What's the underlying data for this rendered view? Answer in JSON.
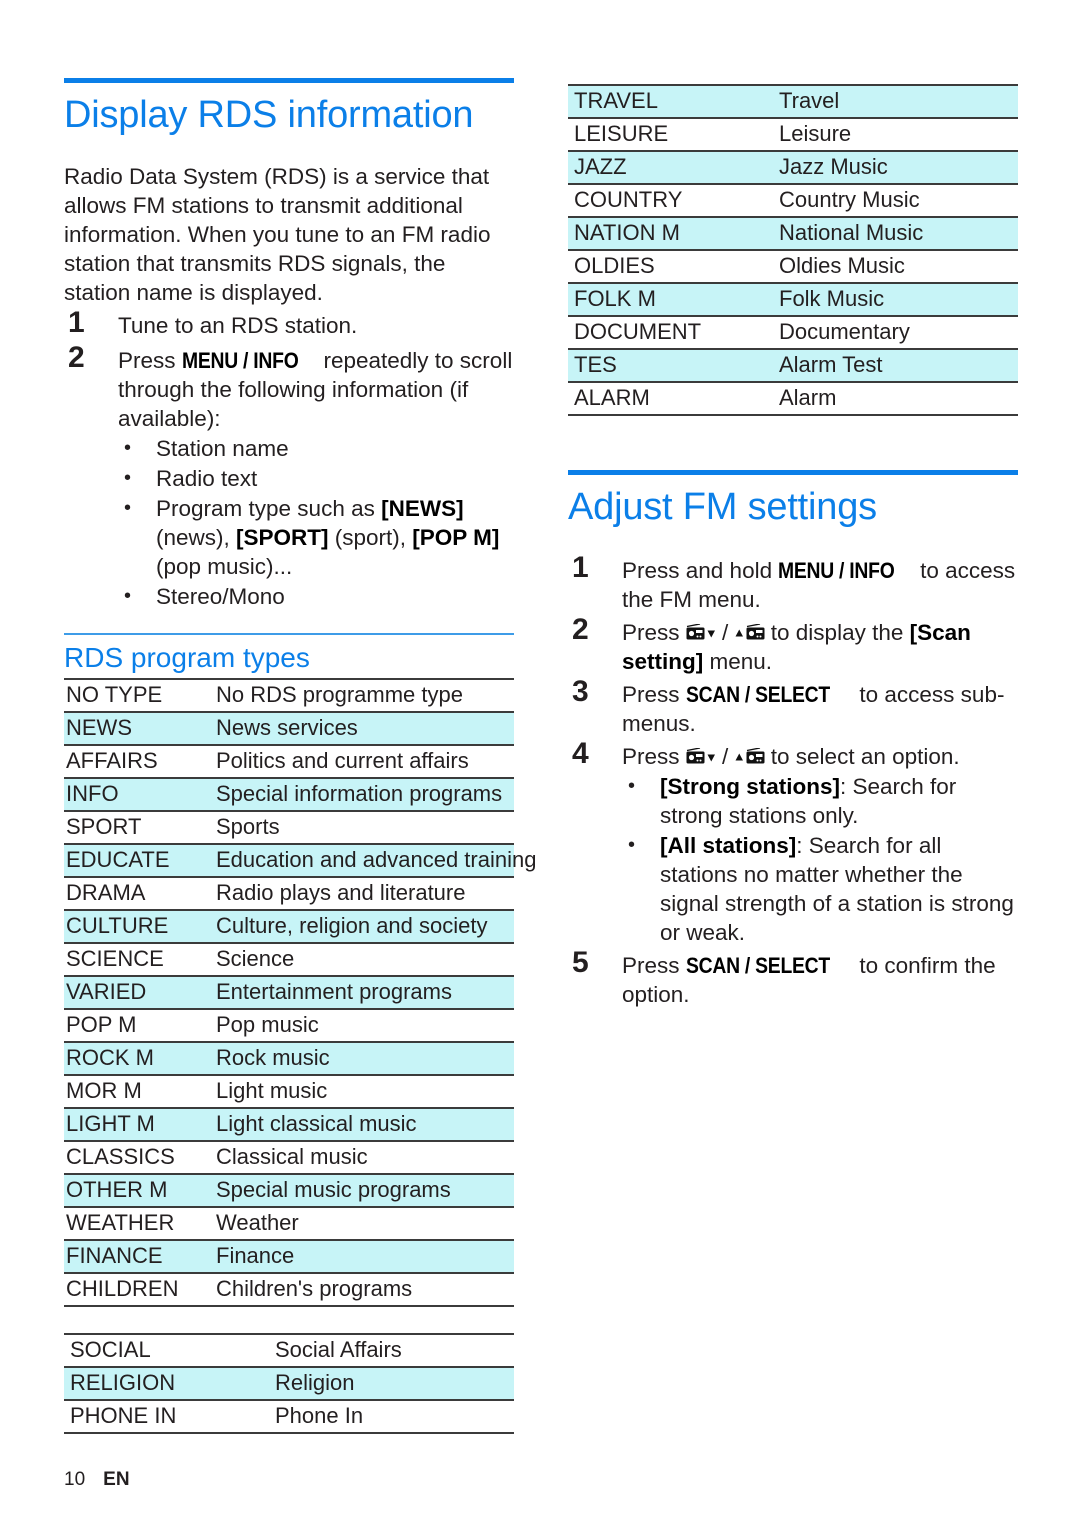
{
  "footer": {
    "page_number": "10",
    "language": "EN"
  },
  "left_column": {
    "section_title": "Display RDS information",
    "intro_paragraph": "Radio Data System (RDS) is a service that allows FM stations to transmit additional information. When you tune to an FM radio station that transmits RDS signals, the station name is displayed.",
    "steps": [
      {
        "num": "1",
        "text": "Tune to an RDS station."
      },
      {
        "num": "2",
        "pre": "Press ",
        "kbd": "MENU / INFO",
        "post": " repeatedly to scroll through the following information (if available):",
        "bullets": [
          {
            "text": "Station name"
          },
          {
            "text": "Radio text"
          },
          {
            "seg1": "Program type such as ",
            "tag1": "[NEWS]",
            "seg2": " (news), ",
            "tag2": "[SPORT]",
            "seg3": " (sport), ",
            "tag3": "[POP M]",
            "seg4": " (pop music)..."
          },
          {
            "text": "Stereo/Mono"
          }
        ]
      }
    ],
    "sub_title": "RDS program types",
    "table_1": [
      {
        "code": "NO TYPE",
        "desc": "No RDS programme type",
        "highlight": false
      },
      {
        "code": "NEWS",
        "desc": "News services",
        "highlight": true
      },
      {
        "code": "AFFAIRS",
        "desc": "Politics and current affairs",
        "highlight": false
      },
      {
        "code": "INFO",
        "desc": "Special information programs",
        "highlight": true
      },
      {
        "code": "SPORT",
        "desc": "Sports",
        "highlight": false
      },
      {
        "code": "EDUCATE",
        "desc": "Education and advanced training",
        "highlight": true
      },
      {
        "code": "DRAMA",
        "desc": "Radio plays and literature",
        "highlight": false
      },
      {
        "code": "CULTURE",
        "desc": "Culture, religion and society",
        "highlight": true
      },
      {
        "code": "SCIENCE",
        "desc": "Science",
        "highlight": false
      },
      {
        "code": "VARIED",
        "desc": "Entertainment programs",
        "highlight": true
      },
      {
        "code": "POP M",
        "desc": "Pop music",
        "highlight": false
      },
      {
        "code": "ROCK M",
        "desc": "Rock music",
        "highlight": true
      },
      {
        "code": "MOR M",
        "desc": "Light music",
        "highlight": false
      },
      {
        "code": "LIGHT M",
        "desc": "Light classical music",
        "highlight": true
      },
      {
        "code": "CLASSICS",
        "desc": "Classical music",
        "highlight": false
      },
      {
        "code": "OTHER M",
        "desc": "Special music programs",
        "highlight": true
      },
      {
        "code": "WEATHER",
        "desc": "Weather",
        "highlight": false
      },
      {
        "code": "FINANCE",
        "desc": "Finance",
        "highlight": true
      },
      {
        "code": "CHILDREN",
        "desc": "Children's programs",
        "highlight": false
      }
    ],
    "table_2": [
      {
        "code": "SOCIAL",
        "desc": "Social Affairs",
        "highlight": false
      },
      {
        "code": "RELIGION",
        "desc": "Religion",
        "highlight": true
      },
      {
        "code": "PHONE IN",
        "desc": "Phone In",
        "highlight": false
      }
    ]
  },
  "right_column": {
    "table_3": [
      {
        "code": "TRAVEL",
        "desc": "Travel",
        "highlight": true
      },
      {
        "code": "LEISURE",
        "desc": "Leisure",
        "highlight": false
      },
      {
        "code": "JAZZ",
        "desc": "Jazz Music",
        "highlight": true
      },
      {
        "code": "COUNTRY",
        "desc": "Country Music",
        "highlight": false
      },
      {
        "code": "NATION M",
        "desc": "National Music",
        "highlight": true
      },
      {
        "code": "OLDIES",
        "desc": "Oldies Music",
        "highlight": false
      },
      {
        "code": "FOLK M",
        "desc": "Folk Music",
        "highlight": true
      },
      {
        "code": "DOCUMENT",
        "desc": "Documentary",
        "highlight": false
      },
      {
        "code": "TES",
        "desc": "Alarm Test",
        "highlight": true
      },
      {
        "code": "ALARM",
        "desc": "Alarm",
        "highlight": false
      }
    ],
    "section_title": "Adjust FM settings",
    "steps": [
      {
        "num": "1",
        "pre": "Press and hold ",
        "kbd": "MENU / INFO",
        "post": " to access the FM menu."
      },
      {
        "num": "2",
        "pre": "Press ",
        "icon_down": "tuner-down-icon",
        "sep": " / ",
        "icon_up": "tuner-up-icon",
        "mid": " to display the ",
        "tag": "[Scan setting]",
        "post": " menu."
      },
      {
        "num": "3",
        "pre": "Press ",
        "kbd": "SCAN / SELECT",
        "post": " to access sub-menus."
      },
      {
        "num": "4",
        "pre": "Press ",
        "icon_down": "tuner-down-icon",
        "sep": " / ",
        "icon_up": "tuner-up-icon",
        "post": " to select an option.",
        "bullets": [
          {
            "tag": "[Strong stations]",
            "text": ": Search for strong stations only."
          },
          {
            "tag": "[All stations]",
            "text": ": Search for all stations no matter whether the signal strength of a station is strong or weak."
          }
        ]
      },
      {
        "num": "5",
        "pre": "Press ",
        "kbd": "SCAN / SELECT",
        "post": " to confirm the option."
      }
    ]
  },
  "colors": {
    "heading_blue": "#0b7fe8",
    "row_highlight": "#c7f4f7",
    "rule_dark": "#3b3b3b",
    "body_text": "#231f20"
  }
}
